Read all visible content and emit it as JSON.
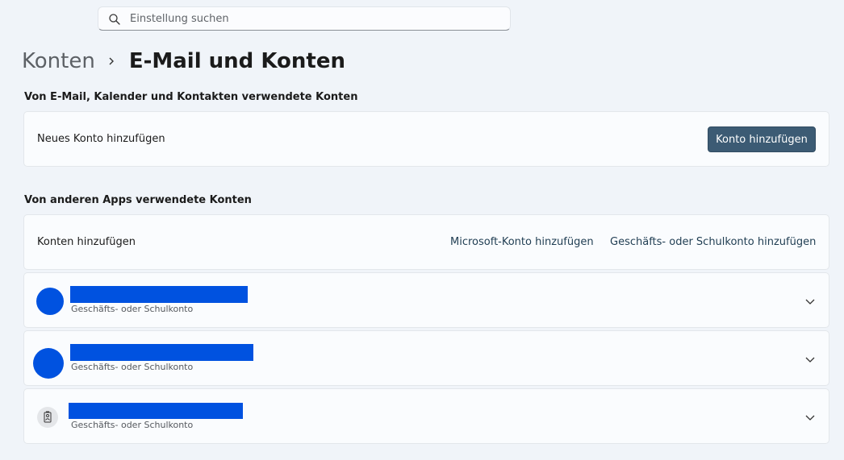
{
  "search": {
    "placeholder": "Einstellung suchen"
  },
  "breadcrumb": {
    "parent": "Konten",
    "current": "E-Mail und Konten"
  },
  "email_section": {
    "title": "Von E-Mail, Kalender und Kontakten verwendete Konten",
    "row_label": "Neues Konto hinzufügen",
    "button_label": "Konto hinzufügen"
  },
  "apps_section": {
    "title": "Von anderen Apps verwendete Konten",
    "row_label": "Konten hinzufügen",
    "microsoft_link": "Microsoft-Konto hinzufügen",
    "work_link": "Geschäfts- oder Schulkonto hinzufügen"
  },
  "accounts": [
    {
      "type": "Geschäfts- oder Schulkonto",
      "avatar": "redacted-avatar"
    },
    {
      "type": "Geschäfts- oder Schulkonto",
      "avatar": "redacted-avatar"
    },
    {
      "type": "Geschäfts- oder Schulkonto",
      "avatar": "id-badge-icon"
    }
  ],
  "colors": {
    "accent_button": "#3c5b74",
    "redaction": "#0052e0",
    "background": "#f0f4f9"
  }
}
